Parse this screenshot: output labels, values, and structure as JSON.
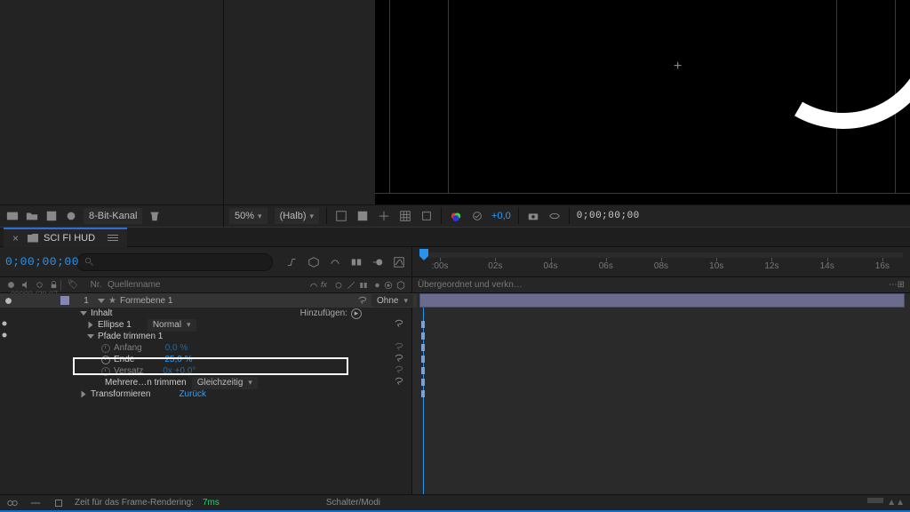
{
  "viewer": {
    "zoom": "50%",
    "resolution": "(Halb)",
    "exposure": "+0,0",
    "timecode": "0;00;00;00"
  },
  "project_toolbar": {
    "depth": "8-Bit-Kanal"
  },
  "comp_tab": {
    "name": "SCI FI HUD"
  },
  "timecode": {
    "current": "0;00;00;00",
    "fps_label": "00000 (29.97 fps)"
  },
  "search": {
    "placeholder": ""
  },
  "ruler": {
    "ticks": [
      ":00s",
      "02s",
      "04s",
      "06s",
      "08s",
      "10s",
      "12s",
      "14s",
      "16s"
    ]
  },
  "columns": {
    "nr": "Nr.",
    "source": "Quellenname",
    "parent": "Übergeordnet und verkn…"
  },
  "layer": {
    "index": "1",
    "name": "Formebene 1",
    "parent_mode": "Ohne"
  },
  "contents": {
    "label": "Inhalt",
    "add_label": "Hinzufügen:",
    "ellipse": "Ellipse 1",
    "mode": "Normal",
    "trim": {
      "label": "Pfade trimmen 1",
      "start_label": "Anfang",
      "start_value": "0,0 %",
      "end_label": "Ende",
      "end_value": "25,0 %",
      "offset_label": "Versatz",
      "offset_value": "0x +0,0°",
      "multi_label": "Mehrere…n trimmen",
      "multi_value": "Gleichzeitig"
    },
    "transform": {
      "label": "Transformieren",
      "reset": "Zurück"
    }
  },
  "status": {
    "render_label": "Zeit für das Frame-Rendering:",
    "render_time": "7ms",
    "switch_label": "Schalter/Modi"
  }
}
